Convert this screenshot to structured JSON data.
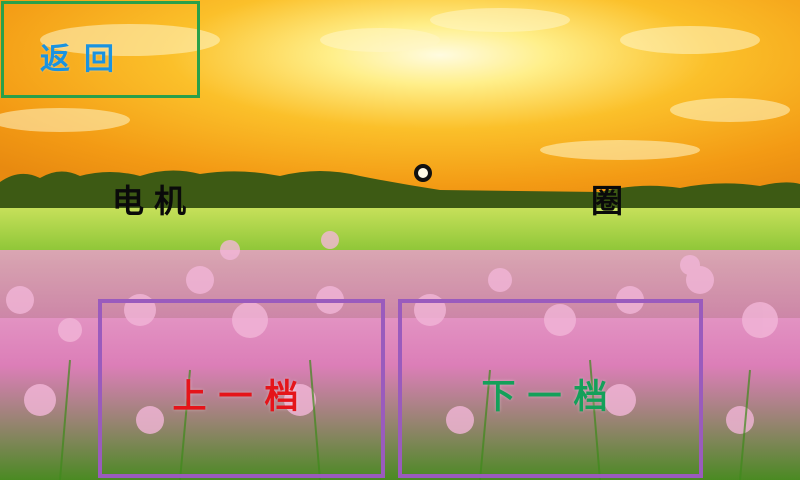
{
  "back_button": {
    "label": "返回",
    "border_color": "#2aa04a",
    "text_color": "#1a93e0"
  },
  "status": {
    "motor_label": "电机",
    "unit_label": "圈"
  },
  "controls": {
    "prev_gear_label": "上一档",
    "next_gear_label": "下一档",
    "border_color": "#9a5bbd",
    "prev_color": "#e5141a",
    "next_color": "#14a05a"
  },
  "background": {
    "icon": "sunset-flower-field-image"
  }
}
